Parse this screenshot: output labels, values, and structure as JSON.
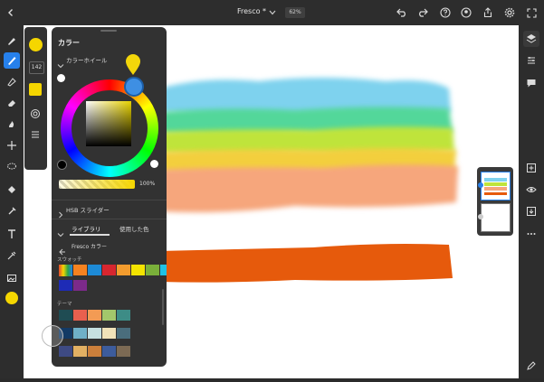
{
  "topbar": {
    "doc_title": "Fresco *",
    "zoom": "62%"
  },
  "panel": {
    "title": "カラー",
    "color_wheel_label": "カラーホイール",
    "opacity_value": "100%",
    "hsb_label": "HSB スライダー",
    "tab_library": "ライブラリ",
    "tab_recent": "使用した色",
    "library_name": "Fresco カラー",
    "swatches_label": "スウォッチ",
    "themes_label": "テーマ"
  },
  "subtool": {
    "size_value": "142"
  },
  "colors": {
    "current": "#f5d600",
    "accent": "#2680eb",
    "panel_bg": "#323232",
    "swatches_row1": [
      "#f58220",
      "#1d8ad6",
      "#d7262f",
      "#f39c2e",
      "#f4e400",
      "#7ab03a",
      "#1ec2e6"
    ],
    "swatches_row2": [
      "#1e2bb6",
      "#7c2a8a"
    ],
    "theme_rows": [
      [
        "#1f4c53",
        "#e9604e",
        "#f39b54",
        "#a3c76b",
        "#3d8c86"
      ],
      [
        "#133a65",
        "#6fb0c7",
        "#c6e0e0",
        "#f1e3b9",
        "#4a6d7c"
      ],
      [
        "#3e4a83",
        "#e2b063",
        "#cb7f3b",
        "#3d5c9c",
        "#7c6a54"
      ]
    ]
  },
  "icons": {
    "back": "chevron-left-icon",
    "undo": "undo-icon",
    "redo": "redo-icon",
    "help": "help-icon",
    "cloud": "cloud-icon",
    "share": "share-icon",
    "settings": "gear-icon",
    "fullscreen": "fullscreen-icon"
  }
}
